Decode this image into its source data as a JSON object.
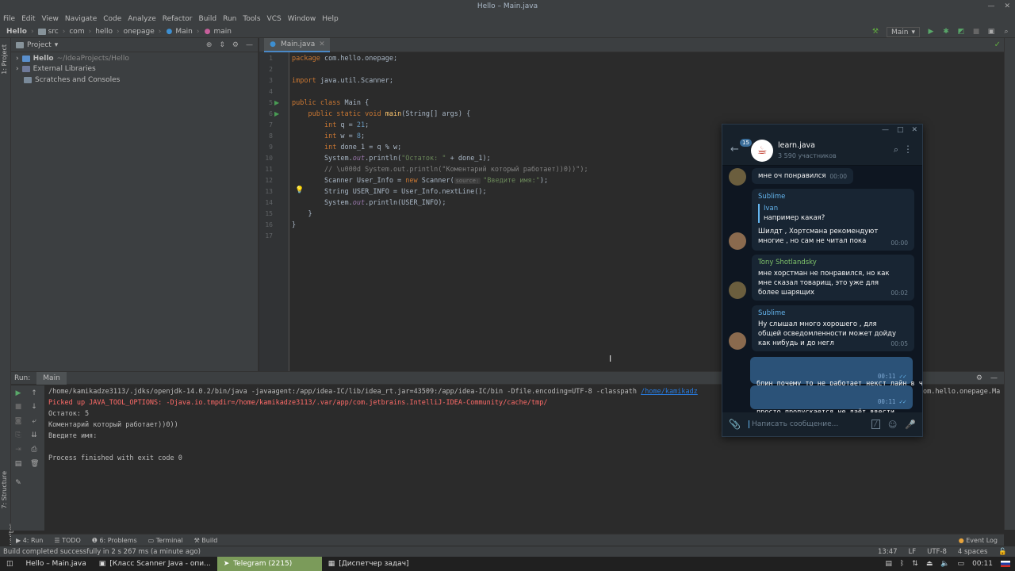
{
  "window": {
    "title": "Hello – Main.java"
  },
  "menu": [
    "File",
    "Edit",
    "View",
    "Navigate",
    "Code",
    "Analyze",
    "Refactor",
    "Build",
    "Run",
    "Tools",
    "VCS",
    "Window",
    "Help"
  ],
  "breadcrumb": [
    "Hello",
    "src",
    "com",
    "hello",
    "onepage",
    "Main",
    "main"
  ],
  "run_config": {
    "selected": "Main"
  },
  "left_tabs": [
    "1: Project",
    "7: Structure",
    "2: Favorites"
  ],
  "project": {
    "header": "Project",
    "items": [
      {
        "name": "Hello",
        "path": "~/IdeaProjects/Hello"
      },
      {
        "name": "External Libraries",
        "path": ""
      },
      {
        "name": "Scratches and Consoles",
        "path": ""
      }
    ]
  },
  "editor": {
    "tab": "Main.java",
    "line_numbers": [
      "1",
      "2",
      "3",
      "4",
      "5",
      "6",
      "7",
      "8",
      "9",
      "10",
      "11",
      "12",
      "13",
      "14",
      "15",
      "16",
      "17"
    ],
    "param_hint": "source:"
  },
  "run_panel": {
    "label": "Run:",
    "tab": "Main",
    "output": [
      "/home/kamikadze3113/.jdks/openjdk-14.0.2/bin/java -javaagent:/app/idea-IC/lib/idea_rt.jar=43509:/app/idea-IC/bin -Dfile.encoding=UTF-8 -classpath",
      "Picked up JAVA_TOOL_OPTIONS: -Djava.io.tmpdir=/home/kamikadze3113/.var/app/com.jetbrains.IntelliJ-IDEA-Community/cache/tmp/",
      "Остаток: 5",
      "Коментарий который работает))0))",
      "Введите имя:",
      "",
      "Process finished with exit code 0"
    ],
    "classpath_link": "/home/kamikadz",
    "classpath_tail": "om.hello.onepage.Ma"
  },
  "bottom_tabs": [
    "4: Run",
    "TODO",
    "6: Problems",
    "Terminal",
    "Build"
  ],
  "event_log": "Event Log",
  "status": {
    "message": "Build completed successfully in 2 s 267 ms (a minute ago)",
    "position": "13:47",
    "line_sep": "LF",
    "encoding": "UTF-8",
    "indent": "4 spaces"
  },
  "taskbar": {
    "items": [
      "Hello – Main.java",
      "[Класс Scanner Java - опи...",
      "Telegram (2215)",
      "[Диспетчер задач]"
    ],
    "clock": "00:11"
  },
  "telegram": {
    "unread": "15",
    "chat_name": "learn.java",
    "members": "3 590 участников",
    "messages": [
      {
        "sender": "",
        "text": "мне оч понравился",
        "time": "00:00"
      },
      {
        "sender": "Sublime",
        "quote_name": "Ivan",
        "quote_text": "например какая?",
        "text": "Шилдт , Хортсмана рекомендуют многие , но сам не читал пока",
        "time": "00:00"
      },
      {
        "sender": "Tony Shotlandsky",
        "text": "мне хорстман не понравился, но как мне сказал товарищ, это уже для более шарящих",
        "time": "00:02"
      },
      {
        "sender": "Sublime",
        "text": "Ну слышал много хорошего , для общей осведомленности может дойду как нибудь и до негл",
        "time": "00:05"
      },
      {
        "sender": "",
        "text": "блин почему то не работает некст лайн в чем может быть проблема",
        "time": "00:11"
      },
      {
        "sender": "",
        "text": "просто пропускается не даёт ввести",
        "time": "00:11"
      }
    ],
    "input_placeholder": "Написать сообщение..."
  },
  "colors": {
    "accent": "#4a88c7",
    "telegram_name_blue": "#64b5ef",
    "telegram_name_green": "#7ec16a",
    "keyword": "#cc7832"
  }
}
